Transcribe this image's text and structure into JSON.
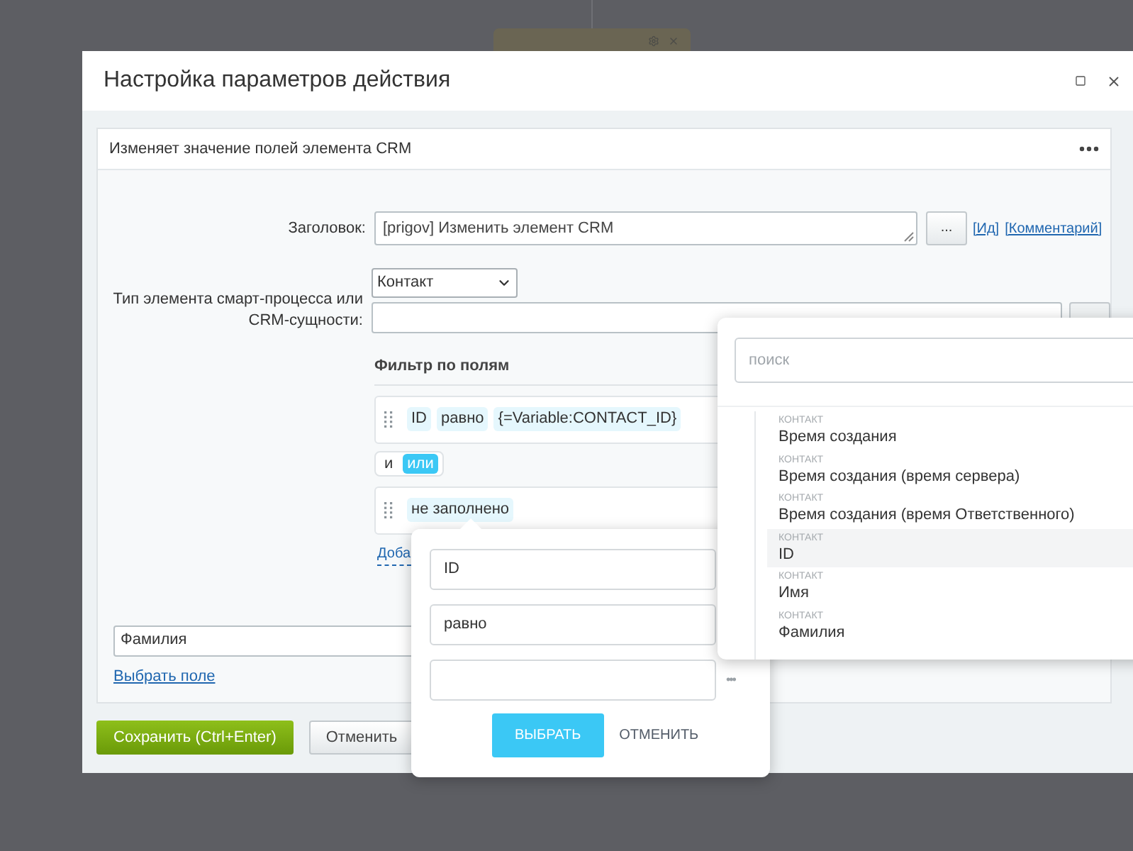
{
  "dialog": {
    "title": "Настройка параметров действия"
  },
  "panel": {
    "header": "Изменяет значение полей элемента CRM",
    "title_field": {
      "label": "Заголовок:",
      "value": "[prigov] Изменить элемент CRM",
      "button": "...",
      "links": [
        "[Ид]",
        "[Комментарий]"
      ]
    },
    "type_field": {
      "label": "Тип элемента смарт-процесса или CRM-сущности:",
      "select": "Контакт"
    },
    "filter": {
      "heading": "Фильтр по полям",
      "conditions": [
        {
          "chips": [
            "ID",
            "равно",
            "{=Variable:CONTACT_ID}"
          ]
        },
        {
          "chips": [
            "не заполнено"
          ]
        }
      ],
      "logic": [
        {
          "label": "и",
          "selected": false
        },
        {
          "label": "или",
          "selected": true
        }
      ],
      "add_link": "Доба"
    },
    "field_value": "Фамилия",
    "choose_field_link": "Выбрать поле"
  },
  "footer": {
    "save": "Сохранить (Ctrl+Enter)",
    "cancel": "Отменить"
  },
  "condition_popup": {
    "fields": [
      "ID",
      "равно"
    ],
    "value_input": {
      "more": "•••"
    },
    "apply": "ВЫБРАТЬ",
    "cancel": "ОТМЕНИТЬ"
  },
  "field_dropdown": {
    "placeholder": "поиск",
    "items": [
      {
        "category": "КОНТАКТ",
        "name": "Время создания",
        "selected": false
      },
      {
        "category": "КОНТАКТ",
        "name": "Время создания (время сервера)",
        "selected": false
      },
      {
        "category": "КОНТАКТ",
        "name": "Время создания (время Ответственного)",
        "selected": false
      },
      {
        "category": "КОНТАКТ",
        "name": "ID",
        "selected": true
      },
      {
        "category": "КОНТАКТ",
        "name": "Имя",
        "selected": false
      },
      {
        "category": "КОНТАКТ",
        "name": "Фамилия",
        "selected": false
      }
    ]
  }
}
